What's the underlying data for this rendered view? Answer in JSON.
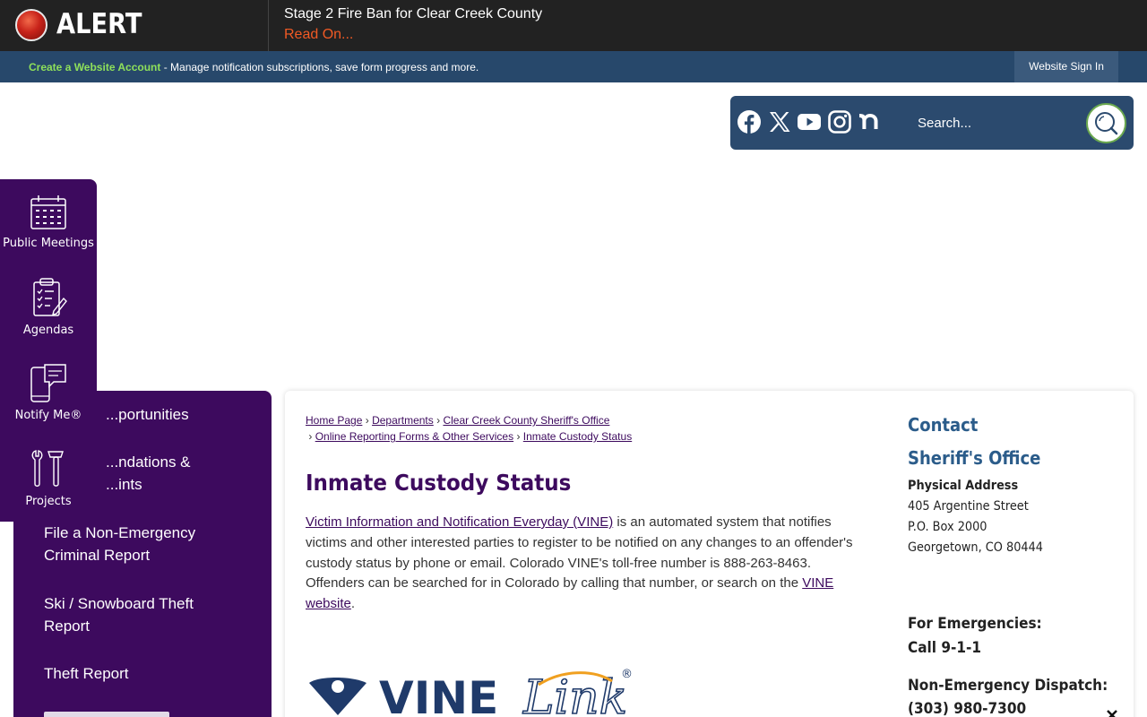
{
  "alert": {
    "label": "ALERT",
    "title": "Stage 2 Fire Ban for Clear Creek County",
    "link": "Read On..."
  },
  "account": {
    "create_link": "Create a Website Account",
    "description": " - Manage notification subscriptions, save form progress and more.",
    "signin": "Website Sign In"
  },
  "social": {
    "icons": [
      "facebook-icon",
      "x-twitter-icon",
      "youtube-icon",
      "instagram-icon",
      "nextdoor-icon"
    ],
    "search_placeholder": "Search..."
  },
  "quick_links": [
    {
      "label": "Public Meetings",
      "icon": "calendar-icon"
    },
    {
      "label": "Agendas",
      "icon": "clipboard-checklist-icon"
    },
    {
      "label": "Notify Me®",
      "icon": "phone-message-icon"
    },
    {
      "label": "Projects",
      "icon": "tools-icon"
    }
  ],
  "side_menu": [
    {
      "line1": "...portunities"
    },
    {
      "line1": "...ndations &",
      "line2": "...ints"
    },
    {
      "line1": "File a Non-Emergency",
      "line2": "Criminal Report"
    },
    {
      "line1": "Ski / Snowboard Theft",
      "line2": "Report"
    },
    {
      "line1": "Theft Report"
    }
  ],
  "breadcrumb": {
    "items": [
      "Home Page",
      "Departments",
      "Clear Creek County Sheriff's Office",
      "Online Reporting Forms & Other Services",
      "Inmate Custody Status"
    ]
  },
  "page": {
    "title": "Inmate Custody Status",
    "vine_link_text": "Victim Information and Notification Everyday (VINE)",
    "body_text": " is an automated system that notifies victims and other interested parties to register to be notified on any changes to an offender's custody status by phone or email. Colorado VINE's toll-free number is 888-263-8463. Offenders can be searched for in Colorado by calling that number, or search on the ",
    "vine_website_link": "VINE website",
    "body_end": ".",
    "logo_text": "VINE",
    "logo_script": "Link",
    "logo_mark": "®"
  },
  "contact": {
    "heading": "Contact",
    "office": "Sheriff's Office",
    "address_label": "Physical Address",
    "address_lines": [
      "405 Argentine Street",
      "P.O. Box 2000",
      "Georgetown, CO 80444"
    ],
    "emergency_label": "For Emergencies:",
    "emergency_value": "Call 9-1-1",
    "non_emergency_label": "Non-Emergency Dispatch:",
    "non_emergency_value": "(303) 980-7300"
  },
  "colors": {
    "purple": "#3d0a5e",
    "navy": "#27486b",
    "alert_orange": "#f15a24",
    "green": "#8ee05a",
    "contact_blue": "#2b5c8a"
  }
}
